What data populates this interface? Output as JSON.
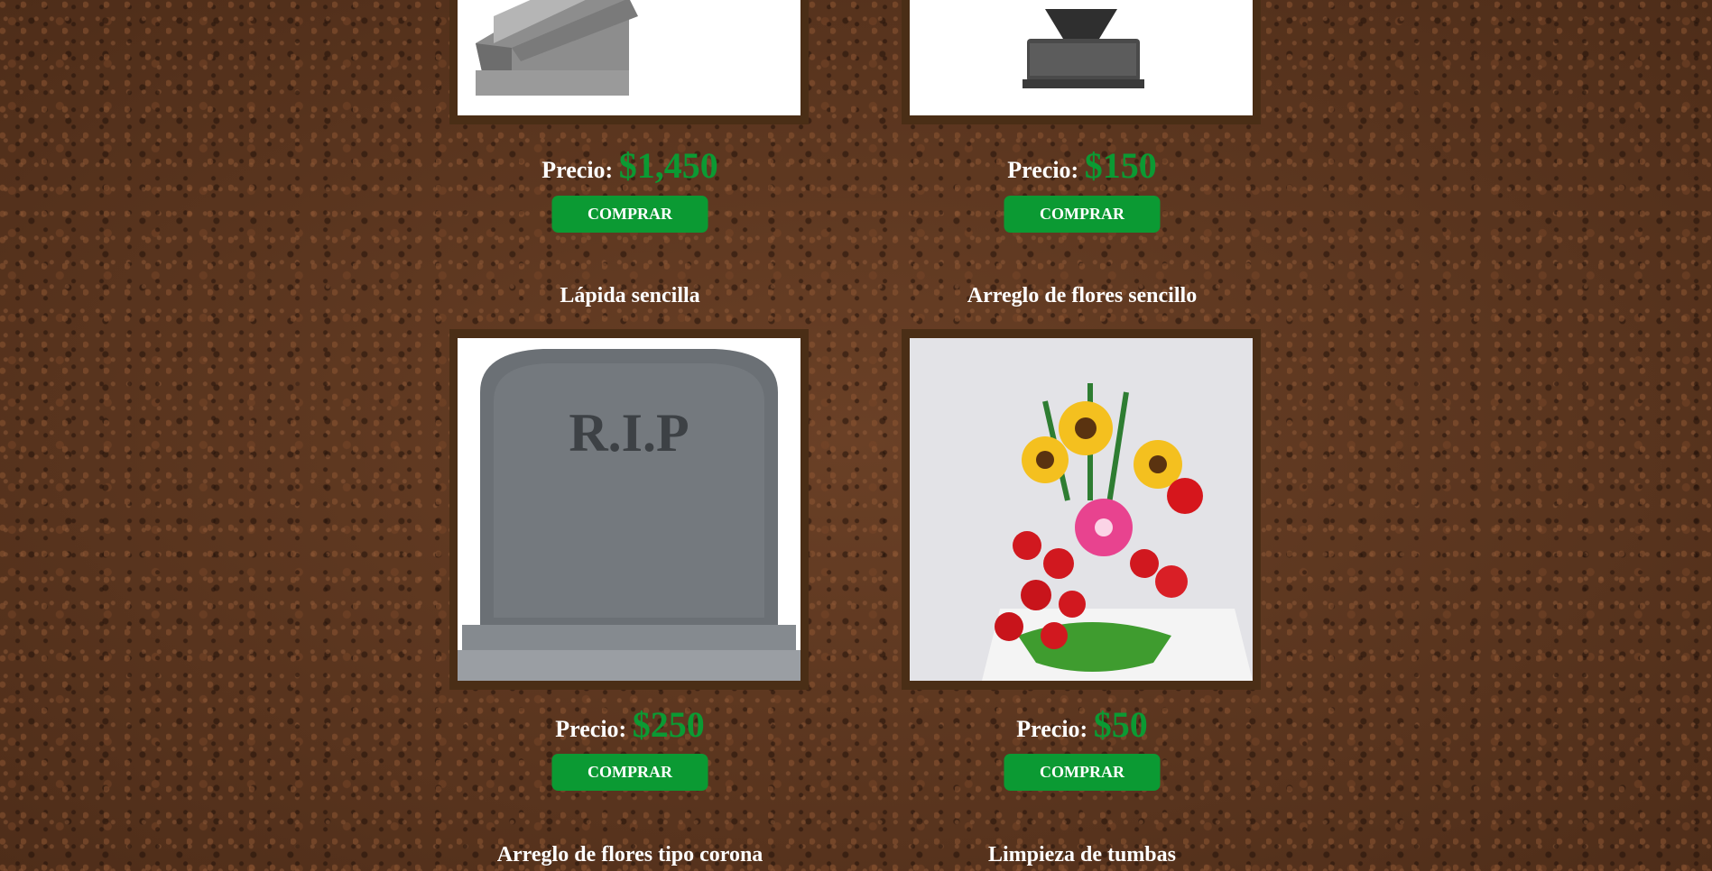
{
  "colors": {
    "price_accent": "#0b9a33",
    "button_bg": "#0b9a33",
    "frame": "#4a2e16"
  },
  "row1": [
    {
      "price_label": "Precio:",
      "price": "$1,450",
      "buy_label": "COMPRAR",
      "image": "coffin-image"
    },
    {
      "price_label": "Precio:",
      "price": "$150",
      "buy_label": "COMPRAR",
      "image": "urn-image"
    }
  ],
  "row2": [
    {
      "title": "Lápida sencilla",
      "price_label": "Precio:",
      "price": "$250",
      "buy_label": "COMPRAR",
      "image": "tombstone-image"
    },
    {
      "title": "Arreglo de flores sencillo",
      "price_label": "Precio:",
      "price": "$50",
      "buy_label": "COMPRAR",
      "image": "flower-arrangement-image"
    }
  ],
  "row3": [
    {
      "title": "Arreglo de flores tipo corona"
    },
    {
      "title": "Limpieza de tumbas"
    }
  ]
}
